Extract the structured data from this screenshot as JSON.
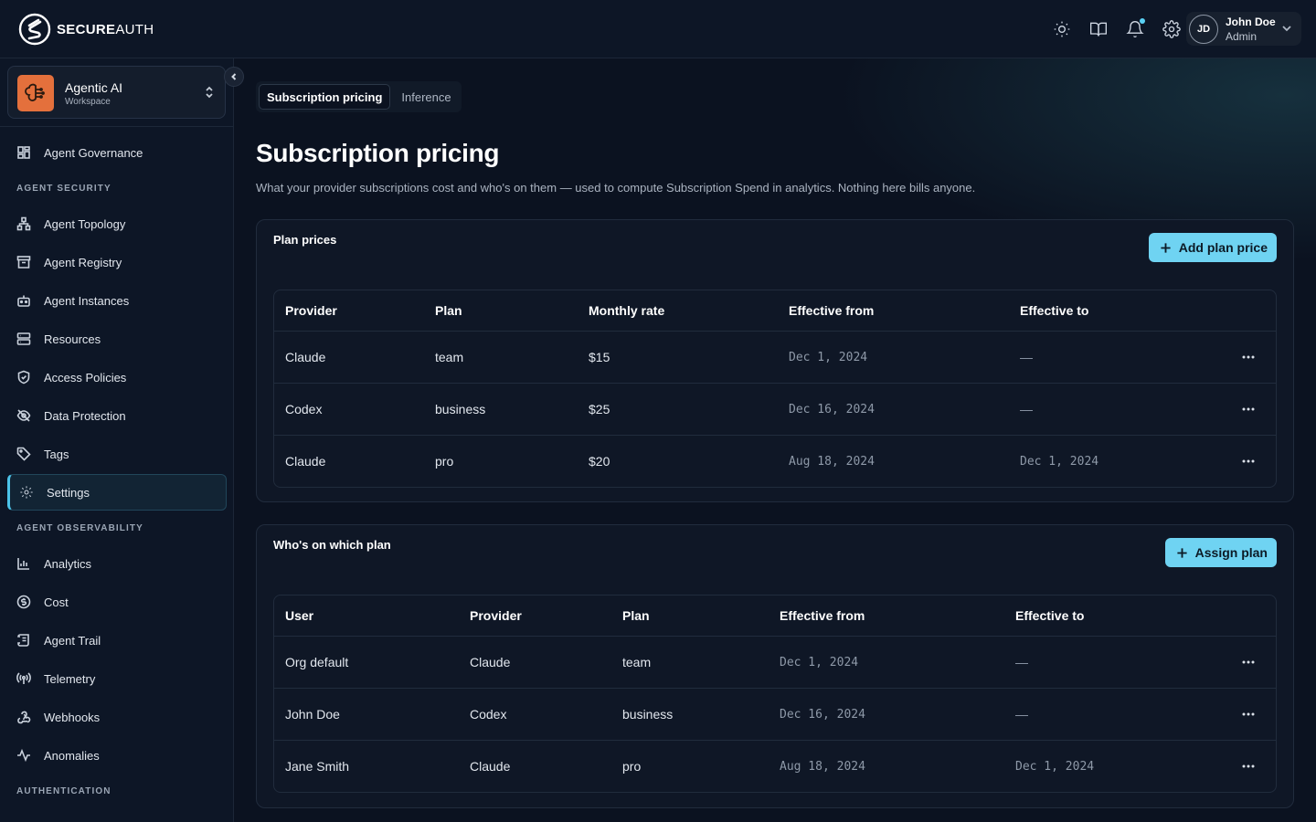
{
  "brand": {
    "bold": "SECURE",
    "light": "AUTH"
  },
  "user": {
    "initials": "JD",
    "name": "John Doe",
    "role": "Admin"
  },
  "workspace": {
    "name": "Agentic AI",
    "type": "Workspace"
  },
  "sidebar": {
    "top_item": {
      "label": "Agent Governance",
      "icon": "grid-icon"
    },
    "sections": [
      {
        "title": "AGENT SECURITY",
        "items": [
          {
            "label": "Agent Topology",
            "icon": "topology-icon"
          },
          {
            "label": "Agent Registry",
            "icon": "archive-icon"
          },
          {
            "label": "Agent Instances",
            "icon": "bot-icon"
          },
          {
            "label": "Resources",
            "icon": "server-icon"
          },
          {
            "label": "Access Policies",
            "icon": "shield-icon"
          },
          {
            "label": "Data Protection",
            "icon": "eye-off-icon"
          },
          {
            "label": "Tags",
            "icon": "tag-icon"
          },
          {
            "label": "Settings",
            "icon": "gear-icon",
            "active": true
          }
        ]
      },
      {
        "title": "AGENT OBSERVABILITY",
        "items": [
          {
            "label": "Analytics",
            "icon": "bar-chart-icon"
          },
          {
            "label": "Cost",
            "icon": "dollar-icon"
          },
          {
            "label": "Agent Trail",
            "icon": "scroll-icon"
          },
          {
            "label": "Telemetry",
            "icon": "radio-icon"
          },
          {
            "label": "Webhooks",
            "icon": "webhook-icon"
          },
          {
            "label": "Anomalies",
            "icon": "activity-icon"
          }
        ]
      },
      {
        "title": "AUTHENTICATION",
        "items": []
      }
    ]
  },
  "tabs": [
    {
      "label": "Subscription pricing",
      "active": true
    },
    {
      "label": "Inference",
      "active": false
    }
  ],
  "page": {
    "title": "Subscription pricing",
    "subtitle": "What your provider subscriptions cost and who's on them — used to compute Subscription Spend in analytics. Nothing here bills anyone."
  },
  "plan_prices": {
    "title": "Plan prices",
    "button": "Add plan price",
    "columns": [
      "Provider",
      "Plan",
      "Monthly rate",
      "Effective from",
      "Effective to"
    ],
    "rows": [
      [
        "Claude",
        "team",
        "$15",
        "Dec 1, 2024",
        "—"
      ],
      [
        "Codex",
        "business",
        "$25",
        "Dec 16, 2024",
        "—"
      ],
      [
        "Claude",
        "pro",
        "$20",
        "Aug 18, 2024",
        "Dec 1, 2024"
      ]
    ]
  },
  "assignments": {
    "title": "Who's on which plan",
    "button": "Assign plan",
    "columns": [
      "User",
      "Provider",
      "Plan",
      "Effective from",
      "Effective to"
    ],
    "rows": [
      [
        "Org default",
        "Claude",
        "team",
        "Dec 1, 2024",
        "—"
      ],
      [
        "John Doe",
        "Codex",
        "business",
        "Dec 16, 2024",
        "—"
      ],
      [
        "Jane Smith",
        "Claude",
        "pro",
        "Aug 18, 2024",
        "Dec 1, 2024"
      ]
    ]
  },
  "colors": {
    "accent": "#6fd3f2",
    "workspace_logo": "#e4703c",
    "background": "#0b1220"
  }
}
